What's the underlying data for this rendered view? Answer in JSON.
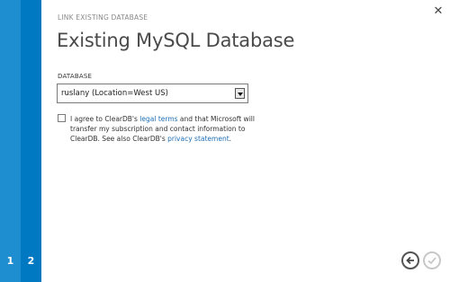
{
  "steps": [
    "1",
    "2"
  ],
  "dialog": {
    "supertitle": "LINK EXISTING DATABASE",
    "title": "Existing MySQL Database"
  },
  "database": {
    "label": "DATABASE",
    "selected": "ruslany (Location=West US)"
  },
  "agreement": {
    "checked": false,
    "text_1": "I agree to ClearDB's ",
    "legal_link": "legal terms",
    "text_2": " and that Microsoft will transfer my subscription and contact information to ClearDB. See also ClearDB's ",
    "privacy_link": "privacy statement",
    "text_3": "."
  },
  "icons": {
    "close": "close-icon",
    "back": "back-arrow-icon",
    "complete": "checkmark-icon"
  },
  "colors": {
    "rail_light": "#1e8ed0",
    "rail_dark": "#0078c2",
    "link": "#1f6fb5"
  }
}
